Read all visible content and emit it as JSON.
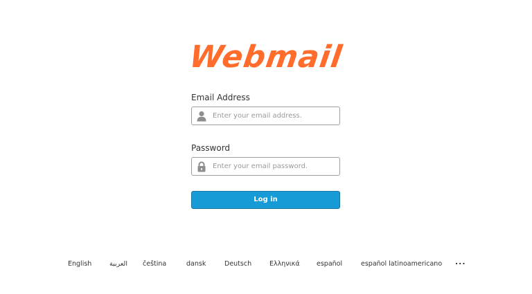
{
  "logo": {
    "text": "Webmail"
  },
  "colors": {
    "logo": "#ff6c2c",
    "button": "#179bd7",
    "input_border": "#9aa0a6"
  },
  "form": {
    "email_label": "Email Address",
    "email_placeholder": "Enter your email address.",
    "email_value": "",
    "email_icon": "user-icon",
    "password_label": "Password",
    "password_placeholder": "Enter your email password.",
    "password_value": "",
    "password_icon": "lock-icon",
    "login_label": "Log in"
  },
  "languages": [
    "English",
    "العربية",
    "čeština",
    "dansk",
    "Deutsch",
    "Ελληνικά",
    "español",
    "español latinoamericano",
    "..."
  ]
}
